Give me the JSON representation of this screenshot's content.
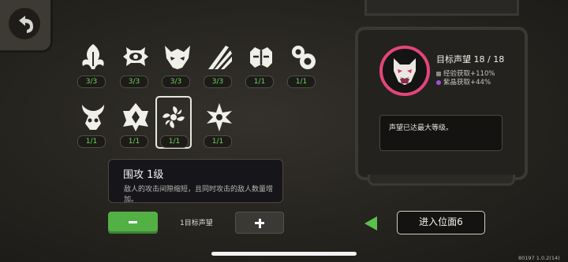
{
  "relics_row1": [
    {
      "icon": "sprout-relic-icon",
      "count": "3/3",
      "full": true
    },
    {
      "icon": "eye-relic-icon",
      "count": "3/3",
      "full": true
    },
    {
      "icon": "demon-mask-relic-icon",
      "count": "3/3",
      "full": true
    },
    {
      "icon": "claw-slash-relic-icon",
      "count": "3/3",
      "full": true
    },
    {
      "icon": "helmet-relic-icon",
      "count": "1/1",
      "full": true
    },
    {
      "icon": "swirl-relic-icon",
      "count": "1/1",
      "full": true
    }
  ],
  "relics_row2": [
    {
      "icon": "horned-skull-relic-icon",
      "count": "1/1",
      "full": true
    },
    {
      "icon": "crest-relic-icon",
      "count": "1/1",
      "full": true
    },
    {
      "icon": "pinwheel-relic-icon",
      "count": "1/1",
      "full": true,
      "selected": true
    },
    {
      "icon": "winged-star-relic-icon",
      "count": "1/1",
      "full": true
    }
  ],
  "skill": {
    "title": "围攻 1级",
    "desc": "敌人的攻击间隙缩短，且同时攻击的敌人数量增加。"
  },
  "cost_label": "1目标声望",
  "reputation": {
    "title": "目标声望 18 / 18",
    "bonus_exp": "经验获取+110%",
    "bonus_crystal": "紫晶获取+44%",
    "max_text": "声望已达最大等级。"
  },
  "enter_label": "进入位面6",
  "version": "80197 1.0.2(14)",
  "colors": {
    "accent_green": "#53b045",
    "avatar_ring": "#e4457a",
    "crystal": "#a050e0"
  }
}
